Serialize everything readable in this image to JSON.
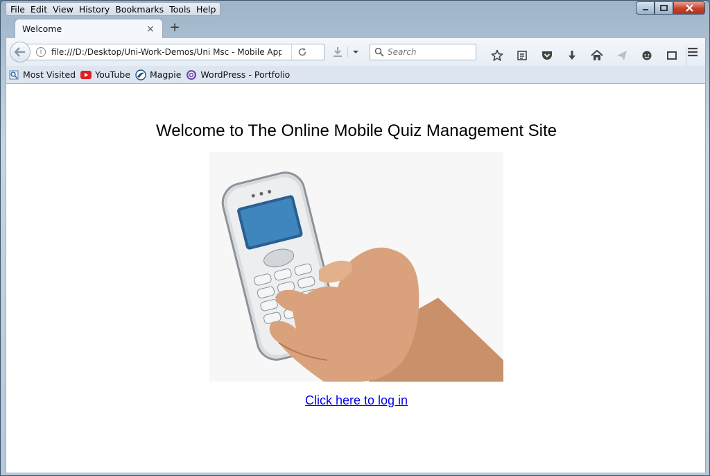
{
  "menu": [
    "File",
    "Edit",
    "View",
    "History",
    "Bookmarks",
    "Tools",
    "Help"
  ],
  "tab": {
    "title": "Welcome"
  },
  "address": {
    "url": "file:///D:/Desktop/Uni-Work-Demos/Uni Msc - Mobile App/We"
  },
  "search": {
    "placeholder": "Search"
  },
  "bookmarks": [
    {
      "label": "Most Visited",
      "icon": "most-visited-icon"
    },
    {
      "label": "YouTube",
      "icon": "youtube-icon"
    },
    {
      "label": "Magpie",
      "icon": "magpie-icon"
    },
    {
      "label": "WordPress - Portfolio",
      "icon": "wordpress-icon"
    }
  ],
  "page": {
    "heading": "Welcome to The Online Mobile Quiz Management Site",
    "login_link": "Click here to log in"
  },
  "colors": {
    "link": "#0000ee",
    "close_button": "#c5402a"
  }
}
